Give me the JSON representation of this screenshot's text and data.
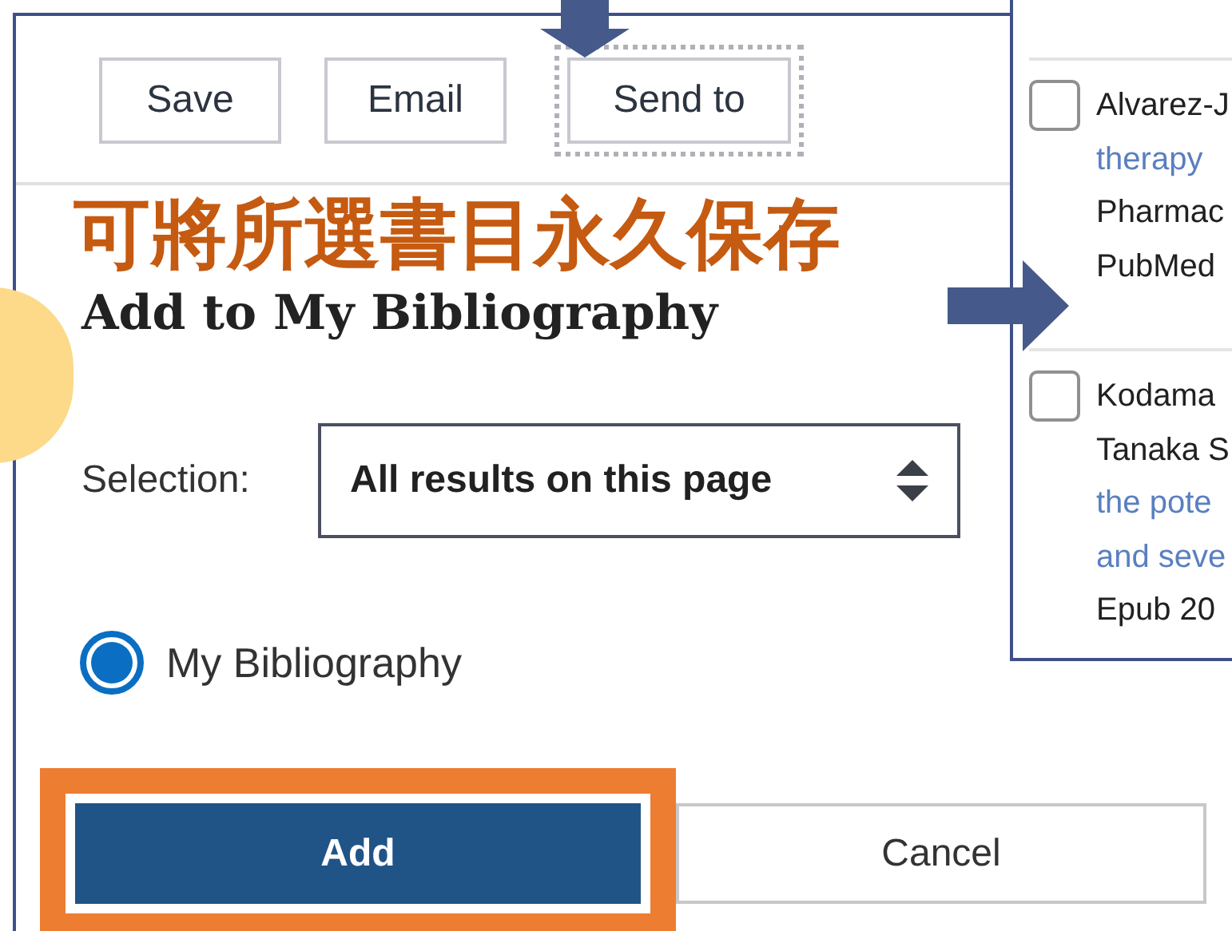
{
  "toolbar_buttons": [
    {
      "label": "Save",
      "focused": false
    },
    {
      "label": "Email",
      "focused": false
    },
    {
      "label": "Send to",
      "focused": true
    }
  ],
  "annotation_text": "可將所選書目永久保存",
  "dialog": {
    "title": "Add to My Bibliography",
    "selection_label": "Selection:",
    "selection_value": "All results on this page",
    "options": [
      {
        "label": "My Bibliography",
        "selected": true
      }
    ],
    "buttons": [
      {
        "label": "Add",
        "kind": "primary",
        "highlighted": true
      },
      {
        "label": "Cancel",
        "kind": "secondary",
        "highlighted": false
      }
    ]
  },
  "results": [
    {
      "checked": false,
      "lines": [
        {
          "text": "Alvarez-J",
          "kind": "plain"
        },
        {
          "text": "therapy",
          "kind": "link"
        },
        {
          "text": "Pharmac",
          "kind": "plain"
        },
        {
          "text": "PubMed",
          "kind": "plain"
        }
      ]
    },
    {
      "checked": false,
      "lines": [
        {
          "text": "Kodama",
          "kind": "plain"
        },
        {
          "text": "Tanaka S",
          "kind": "plain"
        },
        {
          "text": "the pote",
          "kind": "link"
        },
        {
          "text": "and seve",
          "kind": "link"
        },
        {
          "text": "Epub 20",
          "kind": "plain"
        }
      ]
    }
  ]
}
